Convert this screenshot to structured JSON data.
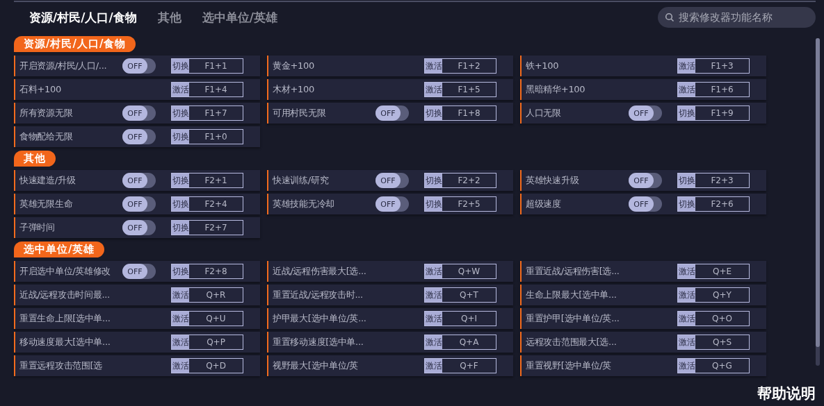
{
  "tabs": [
    {
      "label": "资源/村民/人口/食物",
      "selected": true
    },
    {
      "label": "其他",
      "selected": false
    },
    {
      "label": "选中单位/英雄",
      "selected": false
    }
  ],
  "search": {
    "placeholder": "搜索修改器功能名称"
  },
  "sections": [
    {
      "title": "资源/村民/人口/食物",
      "items": [
        {
          "name": "开启资源/村民/人口/...",
          "kind": "toggle",
          "on": false,
          "switch_label": "OFF",
          "action": "切换",
          "hotkey": "F1+1"
        },
        {
          "name": "黄金+100",
          "kind": "button",
          "action": "激活",
          "hotkey": "F1+2"
        },
        {
          "name": "铁+100",
          "kind": "button",
          "action": "激活",
          "hotkey": "F1+3"
        },
        {
          "name": "石料+100",
          "kind": "button",
          "action": "激活",
          "hotkey": "F1+4"
        },
        {
          "name": "木材+100",
          "kind": "button",
          "action": "激活",
          "hotkey": "F1+5"
        },
        {
          "name": "黑暗精华+100",
          "kind": "button",
          "action": "激活",
          "hotkey": "F1+6"
        },
        {
          "name": "所有资源无限",
          "kind": "toggle",
          "on": false,
          "switch_label": "OFF",
          "action": "切换",
          "hotkey": "F1+7"
        },
        {
          "name": "可用村民无限",
          "kind": "toggle",
          "on": false,
          "switch_label": "OFF",
          "action": "切换",
          "hotkey": "F1+8"
        },
        {
          "name": "人口无限",
          "kind": "toggle",
          "on": false,
          "switch_label": "OFF",
          "action": "切换",
          "hotkey": "F1+9"
        },
        {
          "name": "食物配给无限",
          "kind": "toggle",
          "on": false,
          "switch_label": "OFF",
          "action": "切换",
          "hotkey": "F1+0"
        }
      ]
    },
    {
      "title": "其他",
      "items": [
        {
          "name": "快速建造/升级",
          "kind": "toggle",
          "on": false,
          "switch_label": "OFF",
          "action": "切换",
          "hotkey": "F2+1"
        },
        {
          "name": "快速训练/研究",
          "kind": "toggle",
          "on": false,
          "switch_label": "OFF",
          "action": "切换",
          "hotkey": "F2+2"
        },
        {
          "name": "英雄快速升级",
          "kind": "toggle",
          "on": false,
          "switch_label": "OFF",
          "action": "切换",
          "hotkey": "F2+3"
        },
        {
          "name": "英雄无限生命",
          "kind": "toggle",
          "on": false,
          "switch_label": "OFF",
          "action": "切换",
          "hotkey": "F2+4"
        },
        {
          "name": "英雄技能无冷却",
          "kind": "toggle",
          "on": false,
          "switch_label": "OFF",
          "action": "切换",
          "hotkey": "F2+5"
        },
        {
          "name": "超级速度",
          "kind": "toggle",
          "on": false,
          "switch_label": "OFF",
          "action": "切换",
          "hotkey": "F2+6"
        },
        {
          "name": "子弹时间",
          "kind": "toggle",
          "on": false,
          "switch_label": "OFF",
          "action": "切换",
          "hotkey": "F2+7"
        }
      ]
    },
    {
      "title": "选中单位/英雄",
      "items": [
        {
          "name": "开启选中单位/英雄修改",
          "kind": "toggle",
          "on": false,
          "switch_label": "OFF",
          "action": "切换",
          "hotkey": "F2+8"
        },
        {
          "name": "近战/远程伤害最大[选...",
          "kind": "button",
          "action": "激活",
          "hotkey": "Q+W"
        },
        {
          "name": "重置近战/远程伤害[选...",
          "kind": "button",
          "action": "激活",
          "hotkey": "Q+E"
        },
        {
          "name": "近战/远程攻击时间最...",
          "kind": "button",
          "action": "激活",
          "hotkey": "Q+R"
        },
        {
          "name": "重置近战/远程攻击时...",
          "kind": "button",
          "action": "激活",
          "hotkey": "Q+T"
        },
        {
          "name": "生命上限最大[选中单...",
          "kind": "button",
          "action": "激活",
          "hotkey": "Q+Y"
        },
        {
          "name": "重置生命上限[选中单...",
          "kind": "button",
          "action": "激活",
          "hotkey": "Q+U"
        },
        {
          "name": "护甲最大[选中单位/英...",
          "kind": "button",
          "action": "激活",
          "hotkey": "Q+I"
        },
        {
          "name": "重置护甲[选中单位/英...",
          "kind": "button",
          "action": "激活",
          "hotkey": "Q+O"
        },
        {
          "name": "移动速度最大[选中单...",
          "kind": "button",
          "action": "激活",
          "hotkey": "Q+P"
        },
        {
          "name": "重置移动速度[选中单...",
          "kind": "button",
          "action": "激活",
          "hotkey": "Q+A"
        },
        {
          "name": "远程攻击范围最大[选...",
          "kind": "button",
          "action": "激活",
          "hotkey": "Q+S"
        },
        {
          "name": "重置远程攻击范围[选",
          "kind": "button",
          "action": "激活",
          "hotkey": "Q+D"
        },
        {
          "name": "视野最大[选中单位/英",
          "kind": "button",
          "action": "激活",
          "hotkey": "Q+F"
        },
        {
          "name": "重置视野[选中单位/英",
          "kind": "button",
          "action": "激活",
          "hotkey": "Q+G"
        }
      ]
    }
  ],
  "help": "帮助说明"
}
